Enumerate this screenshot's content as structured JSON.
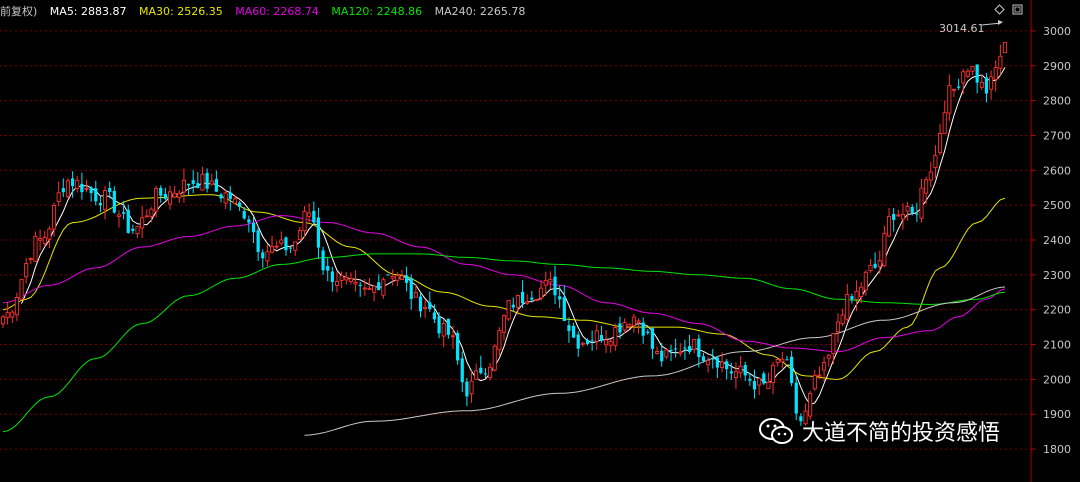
{
  "legend": {
    "prefix": "前复权)",
    "items": [
      {
        "label": "MA5: 2883.87",
        "color": "#ffffff"
      },
      {
        "label": "MA30: 2526.35",
        "color": "#e6e600"
      },
      {
        "label": "MA60: 2268.74",
        "color": "#e600e6"
      },
      {
        "label": "MA120: 2248.86",
        "color": "#00e600"
      },
      {
        "label": "MA240: 2265.78",
        "color": "#c8c8c8"
      }
    ]
  },
  "watermark": {
    "text": "大道不简的投资感悟",
    "icon": "wechat-icon"
  },
  "peak_label": "3014.61",
  "chart_data": {
    "type": "candlestick",
    "ylim": [
      1740,
      3060
    ],
    "yticks": [
      1800,
      1900,
      2000,
      2100,
      2200,
      2300,
      2400,
      2500,
      2600,
      2700,
      2800,
      2900,
      3000
    ],
    "grid": true,
    "colors": {
      "up": "#ff3030",
      "down": "#00e5ff"
    },
    "anchors": [
      [
        0,
        2180
      ],
      [
        8,
        2400
      ],
      [
        14,
        2570
      ],
      [
        22,
        2520
      ],
      [
        28,
        2430
      ],
      [
        34,
        2530
      ],
      [
        42,
        2570
      ],
      [
        48,
        2530
      ],
      [
        52,
        2480
      ],
      [
        56,
        2370
      ],
      [
        62,
        2380
      ],
      [
        66,
        2480
      ],
      [
        70,
        2300
      ],
      [
        78,
        2250
      ],
      [
        84,
        2310
      ],
      [
        90,
        2220
      ],
      [
        96,
        2130
      ],
      [
        100,
        1970
      ],
      [
        104,
        2040
      ],
      [
        110,
        2220
      ],
      [
        114,
        2250
      ],
      [
        118,
        2270
      ],
      [
        124,
        2110
      ],
      [
        130,
        2130
      ],
      [
        136,
        2180
      ],
      [
        142,
        2060
      ],
      [
        148,
        2100
      ],
      [
        152,
        2070
      ],
      [
        158,
        2020
      ],
      [
        164,
        1980
      ],
      [
        168,
        2060
      ],
      [
        172,
        1880
      ],
      [
        176,
        2010
      ],
      [
        182,
        2220
      ],
      [
        188,
        2320
      ],
      [
        192,
        2480
      ],
      [
        196,
        2470
      ],
      [
        200,
        2610
      ],
      [
        204,
        2820
      ],
      [
        208,
        2900
      ],
      [
        212,
        2830
      ],
      [
        216,
        2950
      ]
    ],
    "ma_lines": [
      {
        "name": "MA30",
        "color": "#e6e600",
        "points": [
          [
            0,
            2200
          ],
          [
            5,
            2230
          ],
          [
            15,
            2450
          ],
          [
            30,
            2520
          ],
          [
            45,
            2530
          ],
          [
            55,
            2480
          ],
          [
            65,
            2450
          ],
          [
            75,
            2380
          ],
          [
            85,
            2300
          ],
          [
            95,
            2250
          ],
          [
            105,
            2210
          ],
          [
            115,
            2180
          ],
          [
            125,
            2170
          ],
          [
            135,
            2150
          ],
          [
            145,
            2150
          ],
          [
            155,
            2130
          ],
          [
            165,
            2070
          ],
          [
            173,
            2010
          ],
          [
            180,
            2000
          ],
          [
            188,
            2080
          ],
          [
            195,
            2150
          ],
          [
            202,
            2320
          ],
          [
            210,
            2450
          ],
          [
            216,
            2520
          ]
        ]
      },
      {
        "name": "MA60",
        "color": "#e600e6",
        "points": [
          [
            0,
            2220
          ],
          [
            10,
            2270
          ],
          [
            20,
            2320
          ],
          [
            30,
            2380
          ],
          [
            40,
            2410
          ],
          [
            50,
            2440
          ],
          [
            60,
            2470
          ],
          [
            70,
            2450
          ],
          [
            80,
            2420
          ],
          [
            90,
            2380
          ],
          [
            100,
            2330
          ],
          [
            110,
            2300
          ],
          [
            120,
            2270
          ],
          [
            130,
            2220
          ],
          [
            140,
            2190
          ],
          [
            150,
            2160
          ],
          [
            160,
            2110
          ],
          [
            170,
            2090
          ],
          [
            180,
            2080
          ],
          [
            190,
            2120
          ],
          [
            200,
            2140
          ],
          [
            206,
            2180
          ],
          [
            212,
            2230
          ],
          [
            216,
            2260
          ]
        ]
      },
      {
        "name": "MA120",
        "color": "#00e600",
        "points": [
          [
            0,
            1850
          ],
          [
            10,
            1950
          ],
          [
            20,
            2060
          ],
          [
            30,
            2160
          ],
          [
            40,
            2240
          ],
          [
            50,
            2290
          ],
          [
            60,
            2330
          ],
          [
            70,
            2350
          ],
          [
            80,
            2360
          ],
          [
            90,
            2360
          ],
          [
            100,
            2350
          ],
          [
            110,
            2340
          ],
          [
            120,
            2330
          ],
          [
            130,
            2320
          ],
          [
            140,
            2310
          ],
          [
            150,
            2300
          ],
          [
            160,
            2290
          ],
          [
            170,
            2260
          ],
          [
            180,
            2230
          ],
          [
            190,
            2220
          ],
          [
            200,
            2215
          ],
          [
            210,
            2230
          ],
          [
            216,
            2250
          ]
        ]
      },
      {
        "name": "MA240",
        "color": "#c8c8c8",
        "points": [
          [
            65,
            1840
          ],
          [
            80,
            1880
          ],
          [
            100,
            1910
          ],
          [
            120,
            1960
          ],
          [
            140,
            2010
          ],
          [
            160,
            2080
          ],
          [
            175,
            2120
          ],
          [
            190,
            2170
          ],
          [
            205,
            2220
          ],
          [
            216,
            2265
          ]
        ]
      }
    ]
  }
}
